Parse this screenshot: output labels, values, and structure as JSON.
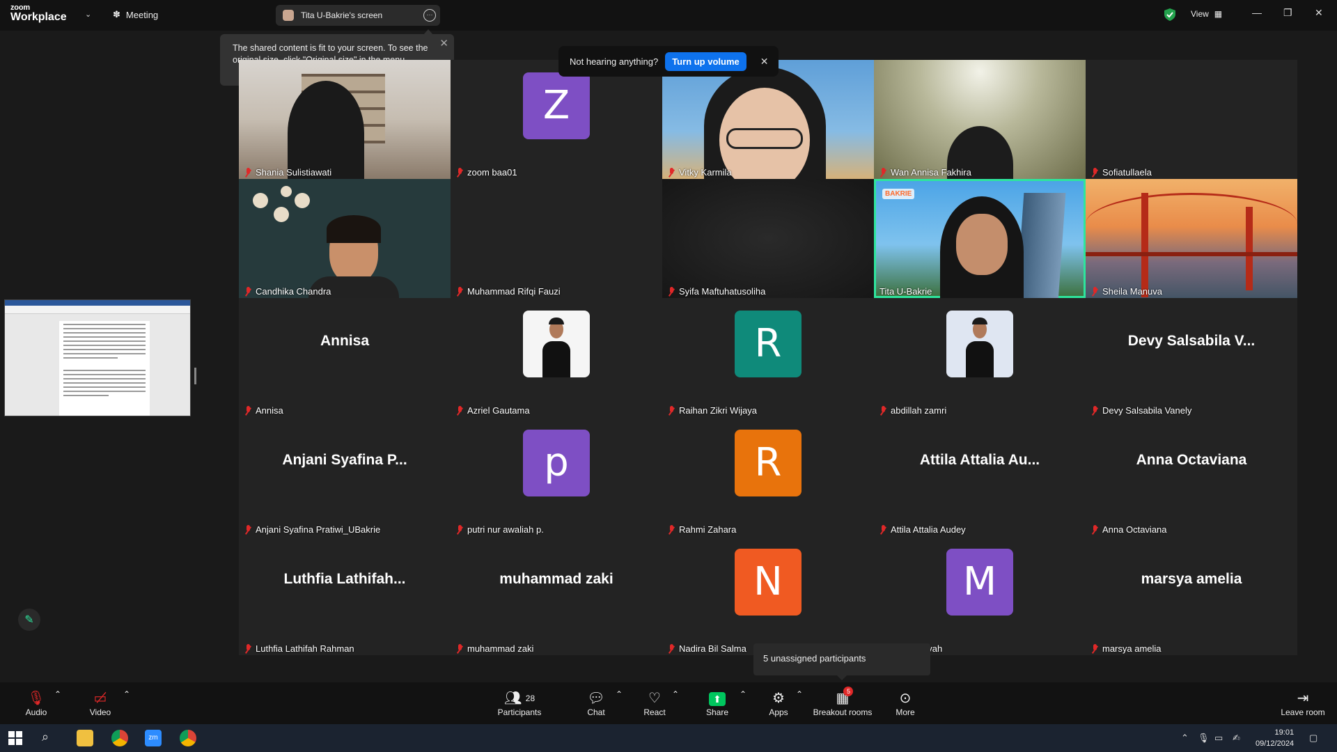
{
  "app": {
    "brand_top": "zoom",
    "brand_bottom": "Workplace",
    "meeting_label": "Meeting"
  },
  "screen_share": {
    "label": "Tita U-Bakrie's screen"
  },
  "topright": {
    "view_label": "View"
  },
  "tooltip": {
    "text": "The shared content is fit to your screen. To see the original size, click \"Original size\" in the menu."
  },
  "audio_banner": {
    "text": "Not hearing anything?",
    "button": "Turn up volume"
  },
  "tiles": [
    {
      "name": "Shania Sulistiawati"
    },
    {
      "name": "zoom baa01",
      "initial": "Z",
      "color": "#7e4fc4"
    },
    {
      "name": "Vitky Karmila"
    },
    {
      "name": "Wan Annisa Fakhira"
    },
    {
      "name": "Sofiatullaela"
    },
    {
      "name": "Candhika Chandra"
    },
    {
      "name": "Muhammad Rifqi Fauzi"
    },
    {
      "name": "Syifa Maftuhatusoliha"
    },
    {
      "name": "Tita U-Bakrie",
      "logo": "BAKRIE"
    },
    {
      "name": "Sheila Manuva"
    },
    {
      "name": "Annisa",
      "display": "Annisa"
    },
    {
      "name": "Azriel Gautama"
    },
    {
      "name": "Raihan Zikri Wijaya",
      "initial": "R",
      "color": "#0f8a7a"
    },
    {
      "name": "abdillah zamri"
    },
    {
      "name": "Devy Salsabila Vanely",
      "display": "Devy Salsabila V..."
    },
    {
      "name": "Anjani Syafina Pratiwi_UBakrie",
      "display": "Anjani Syafina P..."
    },
    {
      "name": "putri nur awaliah p.",
      "initial": "p",
      "color": "#7e4fc4"
    },
    {
      "name": "Rahmi Zahara",
      "initial": "R",
      "color": "#e8730c"
    },
    {
      "name": "Attila Attalia Audey",
      "display": "Attila Attalia Au..."
    },
    {
      "name": "Anna Octaviana",
      "display": "Anna Octaviana"
    },
    {
      "name": "Luthfia Lathifah Rahman",
      "display": "Luthfia  Lathifah..."
    },
    {
      "name": "muhammad zaki",
      "display": "muhammad zaki"
    },
    {
      "name": "Nadira Bil Salma",
      "initial": "N",
      "color": "#f05a22"
    },
    {
      "name": "ayah",
      "initial": "M",
      "color": "#7e4fc4"
    },
    {
      "name": "marsya amelia",
      "display": "marsya amelia"
    }
  ],
  "popover": {
    "text": "5 unassigned participants"
  },
  "toolbar": {
    "audio": "Audio",
    "video": "Video",
    "participants": "Participants",
    "participants_count": "28",
    "chat": "Chat",
    "react": "React",
    "share": "Share",
    "apps": "Apps",
    "breakout": "Breakout rooms",
    "breakout_badge": "5",
    "more": "More",
    "leave": "Leave room"
  },
  "taskbar": {
    "time": "19:01",
    "date": "09/12/2024"
  },
  "colors": {
    "accent": "#0e72ed",
    "active_speaker": "#2ee59d",
    "muted": "#e02828",
    "share_green": "#00c65e"
  }
}
